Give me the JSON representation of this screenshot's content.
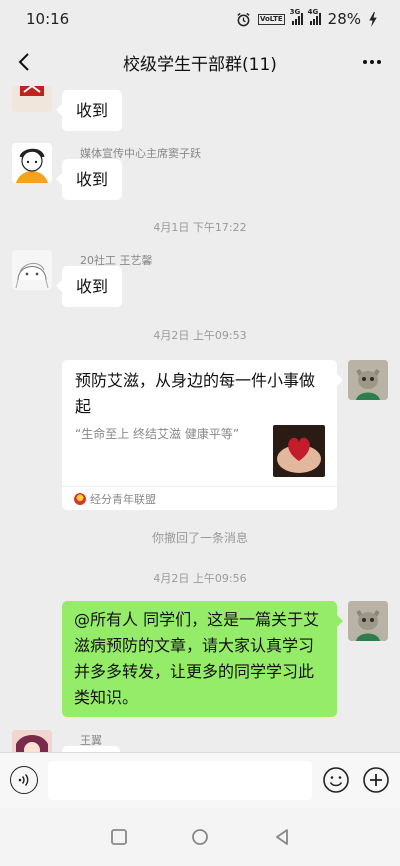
{
  "status_bar": {
    "time": "10:16",
    "volte": "VoLTE",
    "signal1_label": "3G",
    "signal2_label": "4G",
    "battery": "28%"
  },
  "header": {
    "title": "校级学生干部群(11)"
  },
  "messages": [
    {
      "type": "text",
      "side": "left",
      "sender": "",
      "text": "收到"
    },
    {
      "type": "text",
      "side": "left",
      "sender": "媒体宣传中心主席窦子跃",
      "text": "收到"
    },
    {
      "type": "time",
      "text": "4月1日 下午17:22"
    },
    {
      "type": "text",
      "side": "left",
      "sender": "20社工 王艺馨",
      "text": "收到"
    },
    {
      "type": "time",
      "text": "4月2日 上午09:53"
    },
    {
      "type": "card",
      "side": "right",
      "title": "预防艾滋，从身边的每一件小事做起",
      "desc": "“生命至上 终结艾滋 健康平等”",
      "source": "经分青年联盟"
    },
    {
      "type": "system",
      "text": "你撤回了一条消息"
    },
    {
      "type": "time",
      "text": "4月2日 上午09:56"
    },
    {
      "type": "text",
      "side": "right",
      "text": "@所有人  同学们，这是一篇关于艾滋病预防的文章，请大家认真学习并多多转发，让更多的同学学习此类知识。"
    },
    {
      "type": "text",
      "side": "left",
      "sender": "王翼",
      "text": ""
    }
  ],
  "input": {
    "value": "",
    "placeholder": ""
  },
  "colors": {
    "background": "#ededed",
    "self_bubble": "#95ec69",
    "other_bubble": "#ffffff"
  }
}
